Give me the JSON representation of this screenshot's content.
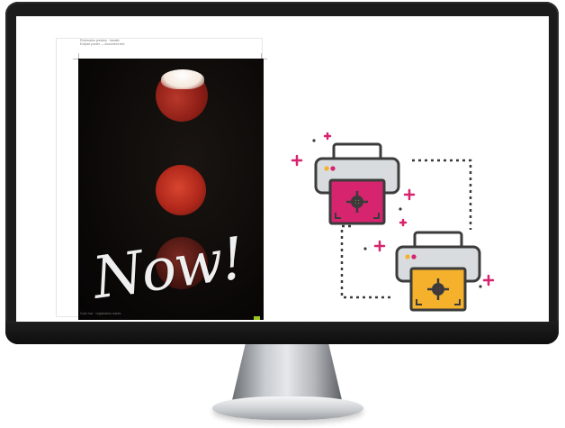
{
  "poster": {
    "header_line1": "Printmarks preview · header",
    "header_line2": "Eclipse poster — document info",
    "headline": "Now!",
    "footer_text": "Color bar · registration marks"
  },
  "colors": {
    "accent_magenta": "#d6246e",
    "accent_yellow": "#f6b12c",
    "printer_body": "#d9dcde",
    "outline": "#3b3b3b",
    "moon_red": "#b0281b"
  },
  "icons": [
    "printer-icon",
    "printer-icon",
    "sparkle-plus-icon",
    "crosshair-icon"
  ]
}
